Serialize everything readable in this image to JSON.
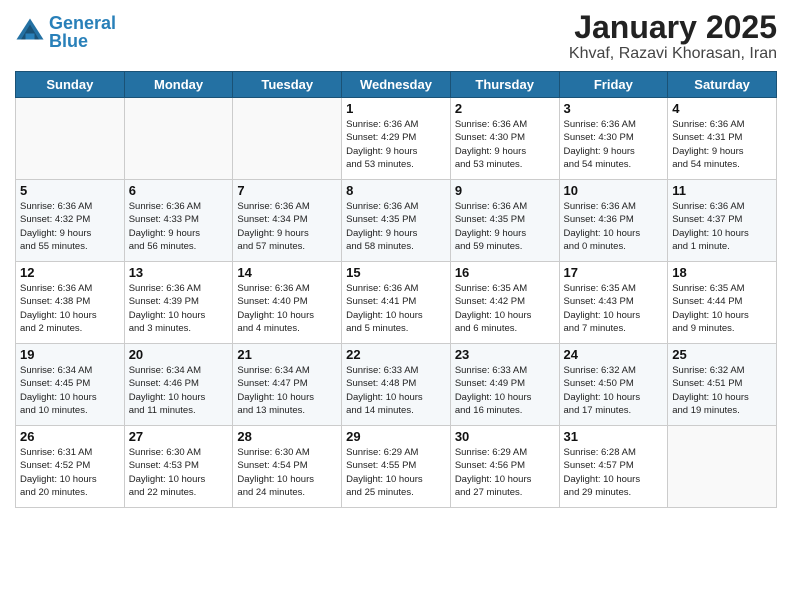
{
  "header": {
    "logo_line1": "General",
    "logo_line2": "Blue",
    "month": "January 2025",
    "location": "Khvaf, Razavi Khorasan, Iran"
  },
  "days_of_week": [
    "Sunday",
    "Monday",
    "Tuesday",
    "Wednesday",
    "Thursday",
    "Friday",
    "Saturday"
  ],
  "weeks": [
    {
      "days": [
        {
          "num": "",
          "info": ""
        },
        {
          "num": "",
          "info": ""
        },
        {
          "num": "",
          "info": ""
        },
        {
          "num": "1",
          "info": "Sunrise: 6:36 AM\nSunset: 4:29 PM\nDaylight: 9 hours\nand 53 minutes."
        },
        {
          "num": "2",
          "info": "Sunrise: 6:36 AM\nSunset: 4:30 PM\nDaylight: 9 hours\nand 53 minutes."
        },
        {
          "num": "3",
          "info": "Sunrise: 6:36 AM\nSunset: 4:30 PM\nDaylight: 9 hours\nand 54 minutes."
        },
        {
          "num": "4",
          "info": "Sunrise: 6:36 AM\nSunset: 4:31 PM\nDaylight: 9 hours\nand 54 minutes."
        }
      ]
    },
    {
      "days": [
        {
          "num": "5",
          "info": "Sunrise: 6:36 AM\nSunset: 4:32 PM\nDaylight: 9 hours\nand 55 minutes."
        },
        {
          "num": "6",
          "info": "Sunrise: 6:36 AM\nSunset: 4:33 PM\nDaylight: 9 hours\nand 56 minutes."
        },
        {
          "num": "7",
          "info": "Sunrise: 6:36 AM\nSunset: 4:34 PM\nDaylight: 9 hours\nand 57 minutes."
        },
        {
          "num": "8",
          "info": "Sunrise: 6:36 AM\nSunset: 4:35 PM\nDaylight: 9 hours\nand 58 minutes."
        },
        {
          "num": "9",
          "info": "Sunrise: 6:36 AM\nSunset: 4:35 PM\nDaylight: 9 hours\nand 59 minutes."
        },
        {
          "num": "10",
          "info": "Sunrise: 6:36 AM\nSunset: 4:36 PM\nDaylight: 10 hours\nand 0 minutes."
        },
        {
          "num": "11",
          "info": "Sunrise: 6:36 AM\nSunset: 4:37 PM\nDaylight: 10 hours\nand 1 minute."
        }
      ]
    },
    {
      "days": [
        {
          "num": "12",
          "info": "Sunrise: 6:36 AM\nSunset: 4:38 PM\nDaylight: 10 hours\nand 2 minutes."
        },
        {
          "num": "13",
          "info": "Sunrise: 6:36 AM\nSunset: 4:39 PM\nDaylight: 10 hours\nand 3 minutes."
        },
        {
          "num": "14",
          "info": "Sunrise: 6:36 AM\nSunset: 4:40 PM\nDaylight: 10 hours\nand 4 minutes."
        },
        {
          "num": "15",
          "info": "Sunrise: 6:36 AM\nSunset: 4:41 PM\nDaylight: 10 hours\nand 5 minutes."
        },
        {
          "num": "16",
          "info": "Sunrise: 6:35 AM\nSunset: 4:42 PM\nDaylight: 10 hours\nand 6 minutes."
        },
        {
          "num": "17",
          "info": "Sunrise: 6:35 AM\nSunset: 4:43 PM\nDaylight: 10 hours\nand 7 minutes."
        },
        {
          "num": "18",
          "info": "Sunrise: 6:35 AM\nSunset: 4:44 PM\nDaylight: 10 hours\nand 9 minutes."
        }
      ]
    },
    {
      "days": [
        {
          "num": "19",
          "info": "Sunrise: 6:34 AM\nSunset: 4:45 PM\nDaylight: 10 hours\nand 10 minutes."
        },
        {
          "num": "20",
          "info": "Sunrise: 6:34 AM\nSunset: 4:46 PM\nDaylight: 10 hours\nand 11 minutes."
        },
        {
          "num": "21",
          "info": "Sunrise: 6:34 AM\nSunset: 4:47 PM\nDaylight: 10 hours\nand 13 minutes."
        },
        {
          "num": "22",
          "info": "Sunrise: 6:33 AM\nSunset: 4:48 PM\nDaylight: 10 hours\nand 14 minutes."
        },
        {
          "num": "23",
          "info": "Sunrise: 6:33 AM\nSunset: 4:49 PM\nDaylight: 10 hours\nand 16 minutes."
        },
        {
          "num": "24",
          "info": "Sunrise: 6:32 AM\nSunset: 4:50 PM\nDaylight: 10 hours\nand 17 minutes."
        },
        {
          "num": "25",
          "info": "Sunrise: 6:32 AM\nSunset: 4:51 PM\nDaylight: 10 hours\nand 19 minutes."
        }
      ]
    },
    {
      "days": [
        {
          "num": "26",
          "info": "Sunrise: 6:31 AM\nSunset: 4:52 PM\nDaylight: 10 hours\nand 20 minutes."
        },
        {
          "num": "27",
          "info": "Sunrise: 6:30 AM\nSunset: 4:53 PM\nDaylight: 10 hours\nand 22 minutes."
        },
        {
          "num": "28",
          "info": "Sunrise: 6:30 AM\nSunset: 4:54 PM\nDaylight: 10 hours\nand 24 minutes."
        },
        {
          "num": "29",
          "info": "Sunrise: 6:29 AM\nSunset: 4:55 PM\nDaylight: 10 hours\nand 25 minutes."
        },
        {
          "num": "30",
          "info": "Sunrise: 6:29 AM\nSunset: 4:56 PM\nDaylight: 10 hours\nand 27 minutes."
        },
        {
          "num": "31",
          "info": "Sunrise: 6:28 AM\nSunset: 4:57 PM\nDaylight: 10 hours\nand 29 minutes."
        },
        {
          "num": "",
          "info": ""
        }
      ]
    }
  ]
}
